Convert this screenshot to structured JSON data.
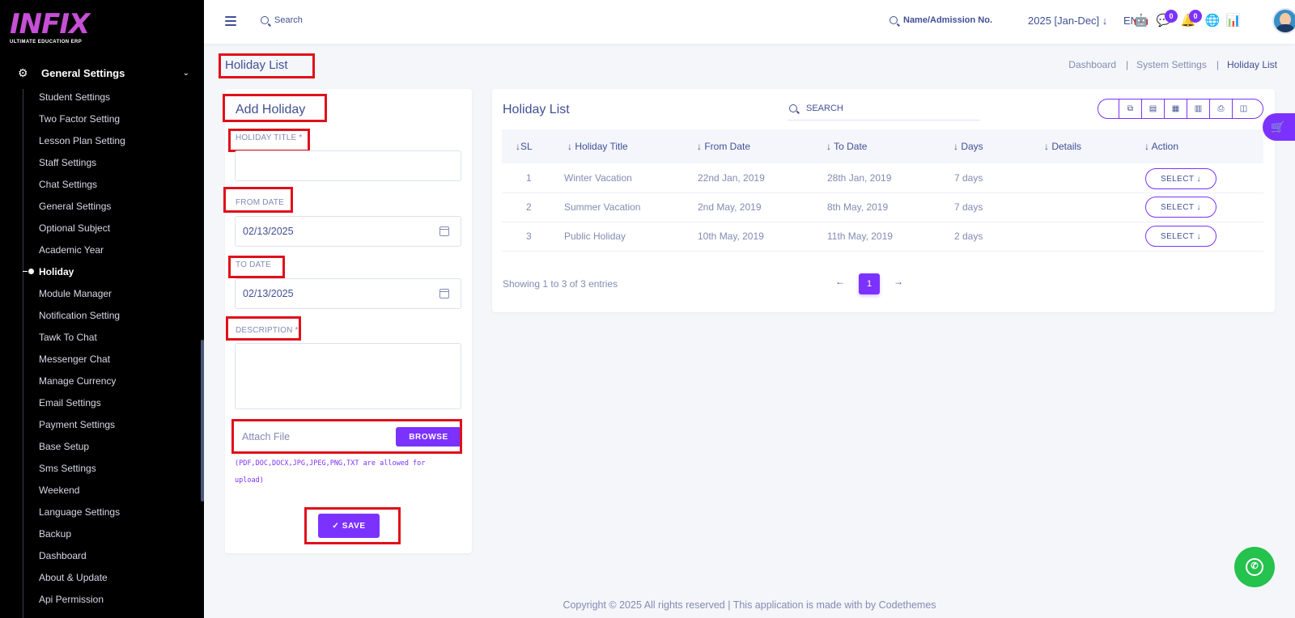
{
  "logo": {
    "text": "INFIX",
    "subtitle": "ULTIMATE EDUCATION ERP"
  },
  "sidebar": {
    "section_label": "General Settings",
    "items": [
      {
        "label": "Student Settings"
      },
      {
        "label": "Two Factor Setting"
      },
      {
        "label": "Lesson Plan Setting"
      },
      {
        "label": "Staff Settings"
      },
      {
        "label": "Chat Settings"
      },
      {
        "label": "General Settings"
      },
      {
        "label": "Optional Subject"
      },
      {
        "label": "Academic Year"
      },
      {
        "label": "Holiday",
        "active": true
      },
      {
        "label": "Module Manager"
      },
      {
        "label": "Notification Setting"
      },
      {
        "label": "Tawk To Chat"
      },
      {
        "label": "Messenger Chat"
      },
      {
        "label": "Manage Currency"
      },
      {
        "label": "Email Settings"
      },
      {
        "label": "Payment Settings"
      },
      {
        "label": "Base Setup"
      },
      {
        "label": "Sms Settings"
      },
      {
        "label": "Weekend"
      },
      {
        "label": "Language Settings"
      },
      {
        "label": "Backup"
      },
      {
        "label": "Dashboard"
      },
      {
        "label": "About & Update"
      },
      {
        "label": "Api Permission"
      }
    ]
  },
  "topbar": {
    "search_label": "Search",
    "name_search_label": "Name/Admission No.",
    "year": "2025 [Jan-Dec]",
    "language": "EN",
    "message_count": "0",
    "notification_count": "0"
  },
  "page": {
    "title": "Holiday List",
    "breadcrumbs": [
      "Dashboard",
      "System Settings",
      "Holiday List"
    ]
  },
  "form": {
    "title": "Add Holiday",
    "holiday_title_label": "HOLIDAY TITLE *",
    "holiday_title_value": "",
    "from_date_label": "FROM DATE",
    "from_date_value": "02/13/2025",
    "to_date_label": "TO DATE",
    "to_date_value": "02/13/2025",
    "description_label": "DESCRIPTION *",
    "attach_placeholder": "Attach File",
    "browse_label": "BROWSE",
    "file_hint": "(PDF,DOC,DOCX,JPG,JPEG,PNG,TXT are allowed for upload)",
    "save_label": "✓ SAVE"
  },
  "list": {
    "title": "Holiday List",
    "search_placeholder": "SEARCH",
    "columns": [
      "SL",
      "Holiday Title",
      "From Date",
      "To Date",
      "Days",
      "Details",
      "Action"
    ],
    "rows": [
      {
        "sl": "1",
        "title": "Winter Vacation",
        "from": "22nd Jan, 2019",
        "to": "28th Jan, 2019",
        "days": "7 days",
        "details": "",
        "action": "SELECT"
      },
      {
        "sl": "2",
        "title": "Summer Vacation",
        "from": "2nd May, 2019",
        "to": "8th May, 2019",
        "days": "7 days",
        "details": "",
        "action": "SELECT"
      },
      {
        "sl": "3",
        "title": "Public Holiday",
        "from": "10th May, 2019",
        "to": "11th May, 2019",
        "days": "2 days",
        "details": "",
        "action": "SELECT"
      }
    ],
    "showing_text": "Showing 1 to 3 of 3 entries",
    "current_page": "1"
  },
  "footer": {
    "text": "Copyright © 2025 All rights reserved | This application is made with by Codethemes"
  },
  "colors": {
    "accent": "#7c32ff",
    "sidebar_bg": "#000000",
    "text": "#415094",
    "muted": "#828bb2",
    "highlight_box": "#e0101a",
    "whatsapp": "#25c24e"
  },
  "icons": [
    "menu-icon",
    "search-icon",
    "robot-icon",
    "message-icon",
    "bell-icon",
    "globe-icon",
    "chart-icon",
    "calendar-icon",
    "whatsapp-icon",
    "cart-icon",
    "gear-icon"
  ]
}
